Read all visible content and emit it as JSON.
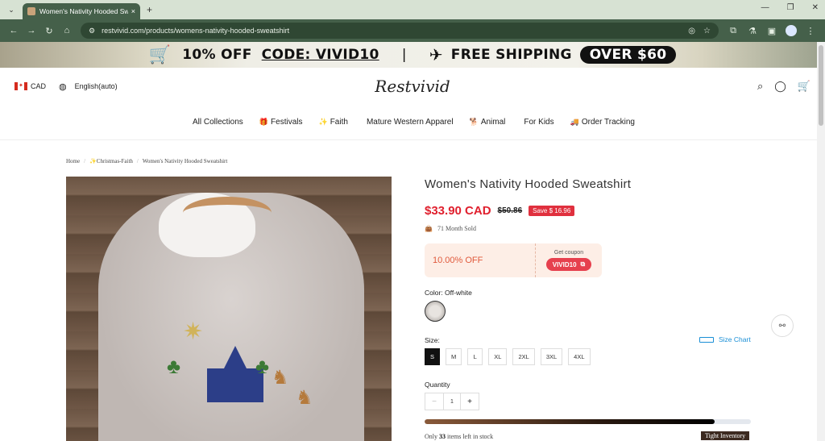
{
  "browser": {
    "tab_title": "Women's Nativity Hooded Sw...",
    "tab_close": "×",
    "new_tab": "+",
    "url": "restvivid.com/products/womens-nativity-hooded-sweatshirt"
  },
  "promo_banner": {
    "offer": "10% OFF",
    "code": "CODE: VIVID10",
    "separator": "|",
    "shipping": "FREE SHIPPING",
    "threshold": "OVER $60"
  },
  "header": {
    "currency": "CAD",
    "language": "English(auto)",
    "logo": "Restvivid"
  },
  "nav": {
    "items": [
      {
        "label": "All Collections",
        "icon": ""
      },
      {
        "label": "Festivals",
        "icon": "🎁"
      },
      {
        "label": "Faith",
        "icon": "✨"
      },
      {
        "label": "Mature Western Apparel",
        "icon": ""
      },
      {
        "label": "Animal",
        "icon": "🐕"
      },
      {
        "label": "For Kids",
        "icon": ""
      },
      {
        "label": "Order Tracking",
        "icon": "🚚"
      }
    ]
  },
  "breadcrumb": {
    "home": "Home",
    "category": "✨Christmas-Faith",
    "current": "Women's Nativity Hooded Sweatshirt",
    "sep": "/"
  },
  "product": {
    "title": "Women's Nativity Hooded Sweatshirt",
    "price": "$33.90 CAD",
    "old_price": "$50.86",
    "save": "Save $ 16.96",
    "sold": "71 Month Sold",
    "coupon_pct": "10.00% OFF",
    "coupon_get": "Get coupon",
    "coupon_code": "VIVID10",
    "color_label": "Color: Off-white",
    "size_label": "Size:",
    "size_chart": "Size Chart",
    "sizes": [
      "S",
      "M",
      "L",
      "XL",
      "2XL",
      "3XL",
      "4XL"
    ],
    "selected_size": "S",
    "qty_label": "Quantity",
    "qty_minus": "−",
    "qty_value": "1",
    "qty_plus": "+",
    "stock_prefix": "Only ",
    "stock_count": "33",
    "stock_suffix": " items left in stock",
    "stock_fill": 0.89,
    "tight_badge": "Tight Inventory"
  },
  "colors": {
    "price": "#e0202e",
    "toolbar": "#45604a",
    "link": "#1a8fd6"
  }
}
